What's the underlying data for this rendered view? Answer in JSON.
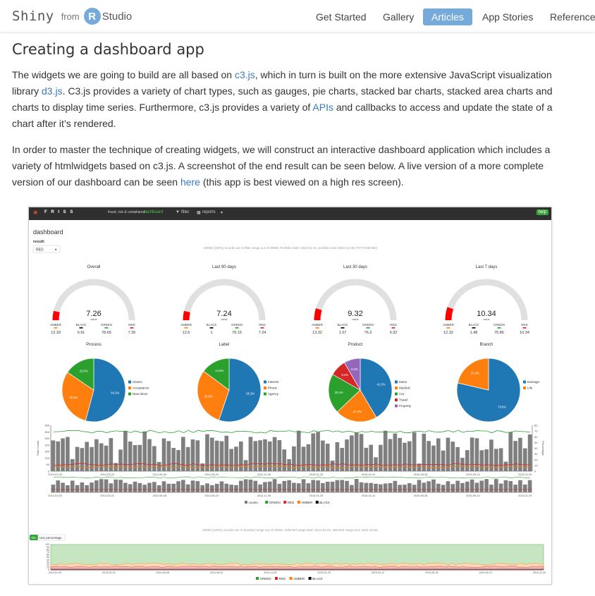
{
  "nav": {
    "brand_shiny": "Shiny",
    "brand_from": "from",
    "brand_r": "R",
    "brand_studio": "Studio",
    "items": [
      {
        "label": "Get Started",
        "active": false
      },
      {
        "label": "Gallery",
        "active": false
      },
      {
        "label": "Articles",
        "active": true
      },
      {
        "label": "App Stories",
        "active": false
      },
      {
        "label": "Reference",
        "active": false
      }
    ]
  },
  "article": {
    "title": "Creating a dashboard app",
    "p1": {
      "t1": "The widgets we are going to build are all based on ",
      "link1": "c3.js",
      "t2": ", which in turn is built on the more extensive JavaScript visualization library ",
      "link2": "d3.js",
      "t3": ". C3.js provides a variety of chart types, such as gauges, pie charts, stacked bar charts, stacked area charts and charts to display time series. Furthermore, c3.js provides a variety of ",
      "link3": "APIs",
      "t4": " and callbacks to access and update the state of a chart after it’s rendered."
    },
    "p2": {
      "t1": "In order to master the technique of creating widgets, we will construct an interactive dashboard application which includes a variety of htmlwidgets based on c3.js. A screenshot of the end result can be seen below. A live version of a more complete version of our dashboard can be seen ",
      "link1": "here",
      "t2": " (this app is best viewed on a high res screen)."
    }
  },
  "dashboard": {
    "nav": {
      "logo": "F R I S S",
      "tagline": "fraud, risk & compliance",
      "tab_dashboard": "dashboard",
      "tab_filter": "filter",
      "tab_reports": "reports",
      "help": "help"
    },
    "title": "dashboard",
    "result_label": "result:",
    "result_value": "RED",
    "filter_note": "20000 (100%) records are in filter range out of 20000. Portfolio start: 2014-01-01, portfolio end: 2015-12-06 (YYYY-MM-DD)",
    "gauge_legend": [
      "AMBER",
      "BLACK",
      "GREEN",
      "RED"
    ],
    "gauge_sub": "value",
    "gauges": [
      {
        "title": "Overall",
        "value": "7.26",
        "legend_values": [
          "13.18",
          "0.91",
          "78.65",
          "7.26"
        ]
      },
      {
        "title": "Last 90 days",
        "value": "7.24",
        "legend_values": [
          "12.6",
          "1",
          "79.15",
          "7.24"
        ]
      },
      {
        "title": "Last 30 days",
        "value": "9.32",
        "legend_values": [
          "13.32",
          "1.07",
          "76.3",
          "9.32"
        ]
      },
      {
        "title": "Last 7 days",
        "value": "10.34",
        "legend_values": [
          "12.32",
          "1.48",
          "75.86",
          "10.34"
        ]
      }
    ],
    "pies": [
      {
        "title": "Process",
        "slices": [
          {
            "label": "Claims",
            "value": 54.16,
            "color": "#1f77b4"
          },
          {
            "label": "Acceptance",
            "value": 30.28,
            "color": "#ff7f0e"
          },
          {
            "label": "New driver",
            "value": 15.56,
            "color": "#2ca02c"
          }
        ]
      },
      {
        "title": "Label",
        "slices": [
          {
            "label": "Internet",
            "value": 55.22,
            "color": "#1f77b4"
          },
          {
            "label": "Phone",
            "value": 29.93,
            "color": "#ff7f0e"
          },
          {
            "label": "Agency",
            "value": 14.85,
            "color": "#2ca02c"
          }
        ]
      },
      {
        "title": "Product",
        "slices": [
          {
            "label": "Motor",
            "value": 41.55,
            "color": "#1f77b4"
          },
          {
            "label": "Medical",
            "value": 21.35,
            "color": "#ff7f0e"
          },
          {
            "label": "Car",
            "value": 20.33,
            "color": "#2ca02c"
          },
          {
            "label": "Travel",
            "value": 8.43,
            "color": "#d62728"
          },
          {
            "label": "Property",
            "value": 8.34,
            "color": "#9467bd"
          }
        ]
      },
      {
        "title": "Branch",
        "slices": [
          {
            "label": "Damage",
            "value": 78.61,
            "color": "#1f77b4"
          },
          {
            "label": "Life",
            "value": 21.39,
            "color": "#ff7f0e"
          }
        ]
      }
    ],
    "ts": {
      "y_left_label": "Total counts",
      "y_right_label": "Percentage",
      "y_left_ticks": [
        "350",
        "300",
        "250",
        "200",
        "150",
        "100",
        "50",
        "0"
      ],
      "y_right_ticks": [
        "80",
        "70",
        "60",
        "50",
        "40",
        "30",
        "20",
        "10",
        "0"
      ],
      "date_ticks": [
        "2014-01-05",
        "2014-03-23",
        "2014-06-08",
        "2014-08-24",
        "2014-11-09",
        "2015-01-25",
        "2015-04-12",
        "2015-06-28",
        "2015-09-13",
        "2015-11-29"
      ],
      "legend": [
        "counts",
        "GREEN",
        "RED",
        "AMBER",
        "BLACK"
      ],
      "legend_colors": [
        "#7f7f7f",
        "#2ca02c",
        "#d62728",
        "#ff7f0e",
        "#000000"
      ]
    },
    "brush_note": "20000 (100%) records are in brushed range out of 20000. Selected range start: 2014-01-01, selected range end: 2015-12-05.",
    "area": {
      "toggle_label": "Use percentage",
      "y_ticks": [
        "100",
        "90",
        "80",
        "70",
        "60",
        "50",
        "40",
        "30",
        "20",
        "10",
        "0"
      ],
      "date_ticks": [
        "2014-01-05",
        "2014-03-23",
        "2014-06-08",
        "2014-08-24",
        "2014-11-09",
        "2015-01-25",
        "2015-04-12",
        "2015-06-28",
        "2015-09-13",
        "2015-11-29"
      ],
      "legend": [
        "GREEN",
        "RED",
        "AMBER",
        "BLACK"
      ],
      "legend_colors": [
        "#2ca02c",
        "#d62728",
        "#ff7f0e",
        "#000000"
      ]
    },
    "colors": {
      "green": "#2ca02c",
      "red": "#d62728",
      "amber": "#ff7f0e",
      "grey": "#7f7f7f",
      "gauge_track": "#e0e0e0",
      "gauge_fill": "#ff0000"
    }
  }
}
